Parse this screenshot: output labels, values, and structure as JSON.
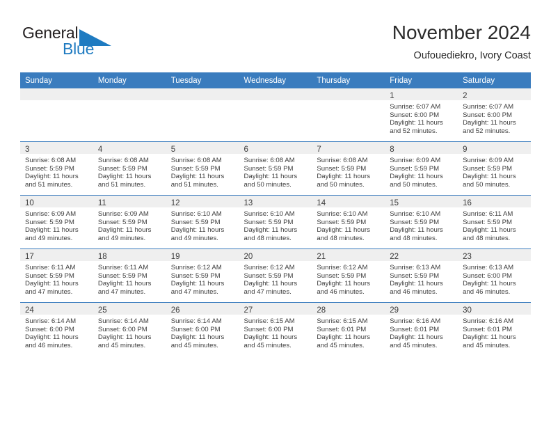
{
  "brand": {
    "name_part1": "General",
    "name_part2": "Blue",
    "triangle_color": "#1f7bc1",
    "icon": "triangle-logo-icon"
  },
  "header": {
    "title": "November 2024",
    "subtitle": "Oufouediekro, Ivory Coast"
  },
  "theme": {
    "header_blue": "#3a7cbe",
    "daynum_band": "#efefef",
    "text": "#3c3c3c"
  },
  "calendar": {
    "weekday_headers": [
      "Sunday",
      "Monday",
      "Tuesday",
      "Wednesday",
      "Thursday",
      "Friday",
      "Saturday"
    ],
    "weeks": [
      [
        {
          "day": "",
          "lines": []
        },
        {
          "day": "",
          "lines": []
        },
        {
          "day": "",
          "lines": []
        },
        {
          "day": "",
          "lines": []
        },
        {
          "day": "",
          "lines": []
        },
        {
          "day": "1",
          "lines": [
            "Sunrise: 6:07 AM",
            "Sunset: 6:00 PM",
            "Daylight: 11 hours",
            "and 52 minutes."
          ]
        },
        {
          "day": "2",
          "lines": [
            "Sunrise: 6:07 AM",
            "Sunset: 6:00 PM",
            "Daylight: 11 hours",
            "and 52 minutes."
          ]
        }
      ],
      [
        {
          "day": "3",
          "lines": [
            "Sunrise: 6:08 AM",
            "Sunset: 5:59 PM",
            "Daylight: 11 hours",
            "and 51 minutes."
          ]
        },
        {
          "day": "4",
          "lines": [
            "Sunrise: 6:08 AM",
            "Sunset: 5:59 PM",
            "Daylight: 11 hours",
            "and 51 minutes."
          ]
        },
        {
          "day": "5",
          "lines": [
            "Sunrise: 6:08 AM",
            "Sunset: 5:59 PM",
            "Daylight: 11 hours",
            "and 51 minutes."
          ]
        },
        {
          "day": "6",
          "lines": [
            "Sunrise: 6:08 AM",
            "Sunset: 5:59 PM",
            "Daylight: 11 hours",
            "and 50 minutes."
          ]
        },
        {
          "day": "7",
          "lines": [
            "Sunrise: 6:08 AM",
            "Sunset: 5:59 PM",
            "Daylight: 11 hours",
            "and 50 minutes."
          ]
        },
        {
          "day": "8",
          "lines": [
            "Sunrise: 6:09 AM",
            "Sunset: 5:59 PM",
            "Daylight: 11 hours",
            "and 50 minutes."
          ]
        },
        {
          "day": "9",
          "lines": [
            "Sunrise: 6:09 AM",
            "Sunset: 5:59 PM",
            "Daylight: 11 hours",
            "and 50 minutes."
          ]
        }
      ],
      [
        {
          "day": "10",
          "lines": [
            "Sunrise: 6:09 AM",
            "Sunset: 5:59 PM",
            "Daylight: 11 hours",
            "and 49 minutes."
          ]
        },
        {
          "day": "11",
          "lines": [
            "Sunrise: 6:09 AM",
            "Sunset: 5:59 PM",
            "Daylight: 11 hours",
            "and 49 minutes."
          ]
        },
        {
          "day": "12",
          "lines": [
            "Sunrise: 6:10 AM",
            "Sunset: 5:59 PM",
            "Daylight: 11 hours",
            "and 49 minutes."
          ]
        },
        {
          "day": "13",
          "lines": [
            "Sunrise: 6:10 AM",
            "Sunset: 5:59 PM",
            "Daylight: 11 hours",
            "and 48 minutes."
          ]
        },
        {
          "day": "14",
          "lines": [
            "Sunrise: 6:10 AM",
            "Sunset: 5:59 PM",
            "Daylight: 11 hours",
            "and 48 minutes."
          ]
        },
        {
          "day": "15",
          "lines": [
            "Sunrise: 6:10 AM",
            "Sunset: 5:59 PM",
            "Daylight: 11 hours",
            "and 48 minutes."
          ]
        },
        {
          "day": "16",
          "lines": [
            "Sunrise: 6:11 AM",
            "Sunset: 5:59 PM",
            "Daylight: 11 hours",
            "and 48 minutes."
          ]
        }
      ],
      [
        {
          "day": "17",
          "lines": [
            "Sunrise: 6:11 AM",
            "Sunset: 5:59 PM",
            "Daylight: 11 hours",
            "and 47 minutes."
          ]
        },
        {
          "day": "18",
          "lines": [
            "Sunrise: 6:11 AM",
            "Sunset: 5:59 PM",
            "Daylight: 11 hours",
            "and 47 minutes."
          ]
        },
        {
          "day": "19",
          "lines": [
            "Sunrise: 6:12 AM",
            "Sunset: 5:59 PM",
            "Daylight: 11 hours",
            "and 47 minutes."
          ]
        },
        {
          "day": "20",
          "lines": [
            "Sunrise: 6:12 AM",
            "Sunset: 5:59 PM",
            "Daylight: 11 hours",
            "and 47 minutes."
          ]
        },
        {
          "day": "21",
          "lines": [
            "Sunrise: 6:12 AM",
            "Sunset: 5:59 PM",
            "Daylight: 11 hours",
            "and 46 minutes."
          ]
        },
        {
          "day": "22",
          "lines": [
            "Sunrise: 6:13 AM",
            "Sunset: 5:59 PM",
            "Daylight: 11 hours",
            "and 46 minutes."
          ]
        },
        {
          "day": "23",
          "lines": [
            "Sunrise: 6:13 AM",
            "Sunset: 6:00 PM",
            "Daylight: 11 hours",
            "and 46 minutes."
          ]
        }
      ],
      [
        {
          "day": "24",
          "lines": [
            "Sunrise: 6:14 AM",
            "Sunset: 6:00 PM",
            "Daylight: 11 hours",
            "and 46 minutes."
          ]
        },
        {
          "day": "25",
          "lines": [
            "Sunrise: 6:14 AM",
            "Sunset: 6:00 PM",
            "Daylight: 11 hours",
            "and 45 minutes."
          ]
        },
        {
          "day": "26",
          "lines": [
            "Sunrise: 6:14 AM",
            "Sunset: 6:00 PM",
            "Daylight: 11 hours",
            "and 45 minutes."
          ]
        },
        {
          "day": "27",
          "lines": [
            "Sunrise: 6:15 AM",
            "Sunset: 6:00 PM",
            "Daylight: 11 hours",
            "and 45 minutes."
          ]
        },
        {
          "day": "28",
          "lines": [
            "Sunrise: 6:15 AM",
            "Sunset: 6:01 PM",
            "Daylight: 11 hours",
            "and 45 minutes."
          ]
        },
        {
          "day": "29",
          "lines": [
            "Sunrise: 6:16 AM",
            "Sunset: 6:01 PM",
            "Daylight: 11 hours",
            "and 45 minutes."
          ]
        },
        {
          "day": "30",
          "lines": [
            "Sunrise: 6:16 AM",
            "Sunset: 6:01 PM",
            "Daylight: 11 hours",
            "and 45 minutes."
          ]
        }
      ]
    ]
  }
}
